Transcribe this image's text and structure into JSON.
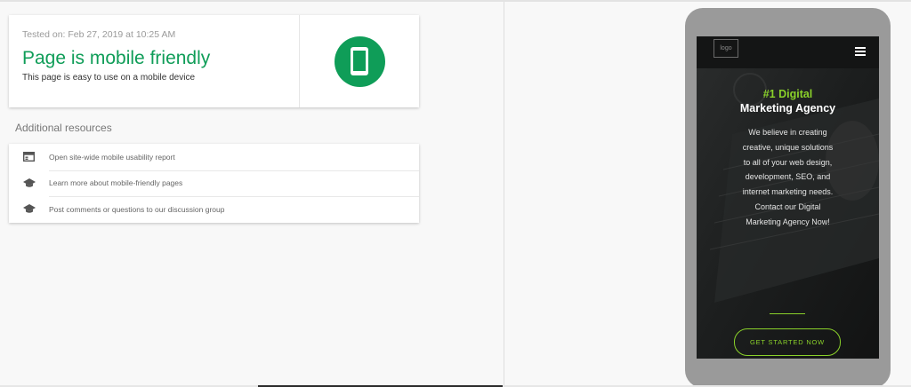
{
  "result": {
    "tested_on": "Tested on: Feb 27, 2019 at 10:25 AM",
    "title": "Page is mobile friendly",
    "description": "This page is easy to use on a mobile device",
    "icon": "smartphone-icon",
    "accent_color": "#0f9d58"
  },
  "resources": {
    "heading": "Additional resources",
    "items": [
      {
        "icon": "report-icon",
        "label": "Open site-wide mobile usability report"
      },
      {
        "icon": "school-icon",
        "label": "Learn more about mobile-friendly pages"
      },
      {
        "icon": "school-icon",
        "label": "Post comments or questions to our discussion group"
      }
    ]
  },
  "preview": {
    "logo_text": "logo",
    "menu_icon": "hamburger-menu-icon",
    "hero_accent": "#1 Digital",
    "hero_title": "Marketing Agency",
    "hero_body": "We believe in creating creative, unique solutions to all of your web design, development, SEO, and internet marketing needs. Contact our Digital Marketing Agency Now!",
    "cta_label": "GET STARTED NOW",
    "accent_color": "#8ad12a"
  }
}
